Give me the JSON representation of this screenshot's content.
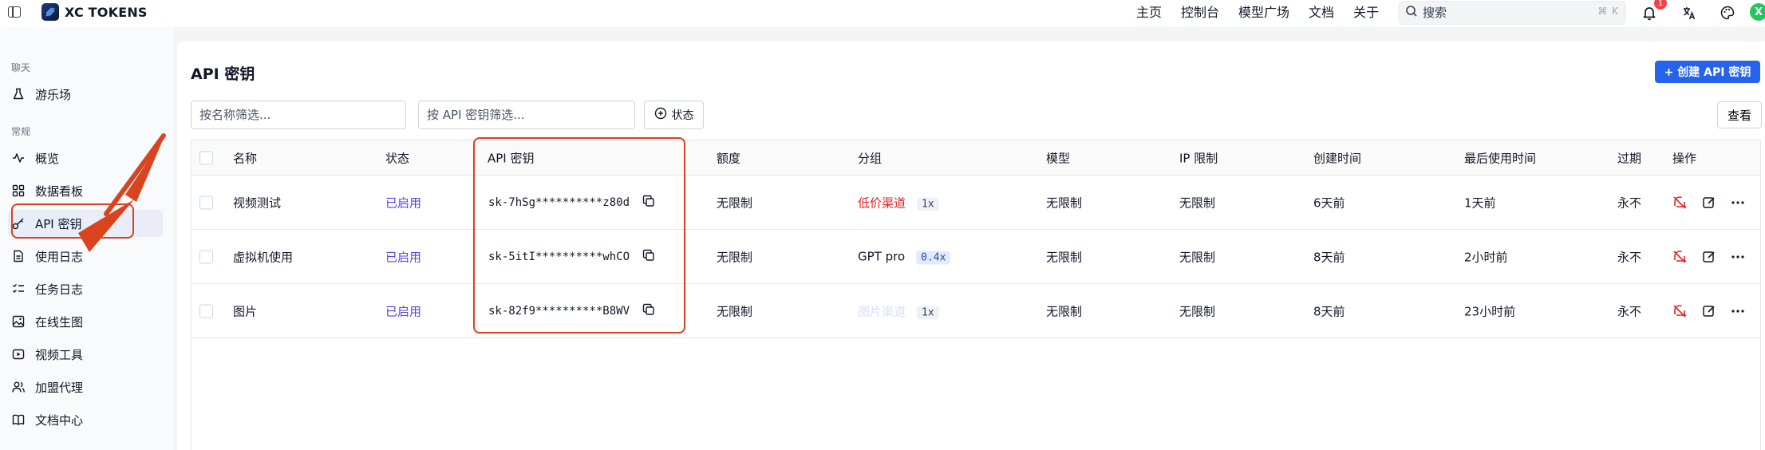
{
  "app": {
    "title": "XC TOKENS"
  },
  "topnav": {
    "items": [
      "主页",
      "控制台",
      "模型广场",
      "文档",
      "关于"
    ]
  },
  "search": {
    "placeholder": "搜索",
    "shortcut": "⌘ K"
  },
  "notifications": {
    "count": "1"
  },
  "user": {
    "avatar_letter": "X"
  },
  "sidebar": {
    "section_chat": "聊天",
    "section_general": "常规",
    "items": [
      {
        "label": "游乐场",
        "icon": "flask-icon"
      },
      {
        "label": "概览",
        "icon": "activity-icon"
      },
      {
        "label": "数据看板",
        "icon": "dashboard-icon"
      },
      {
        "label": "API 密钥",
        "icon": "key-icon",
        "active": true
      },
      {
        "label": "使用日志",
        "icon": "file-text-icon"
      },
      {
        "label": "任务日志",
        "icon": "list-checks-icon"
      },
      {
        "label": "在线生图",
        "icon": "image-icon"
      },
      {
        "label": "视频工具",
        "icon": "video-icon"
      },
      {
        "label": "加盟代理",
        "icon": "users-icon"
      },
      {
        "label": "文档中心",
        "icon": "book-icon"
      }
    ]
  },
  "page": {
    "title": "API 密钥",
    "create_label": "+ 创建 API 密钥",
    "filter_name_placeholder": "按名称筛选...",
    "filter_key_placeholder": "按 API 密钥筛选...",
    "status_filter_label": "状态",
    "view_label": "查看"
  },
  "table": {
    "headers": [
      "名称",
      "状态",
      "API 密钥",
      "额度",
      "分组",
      "模型",
      "IP 限制",
      "创建时间",
      "最后使用时间",
      "过期",
      "操作"
    ],
    "rows": [
      {
        "name": "视频测试",
        "status": "已启用",
        "key": "sk-7hSg**********z80d",
        "quota": "无限制",
        "group": "低价渠道",
        "group_style": "red",
        "ratio": "1x",
        "ratio_style": "gray",
        "model": "无限制",
        "ip": "无限制",
        "created": "6天前",
        "last_used": "1天前",
        "expires": "永不"
      },
      {
        "name": "虚拟机使用",
        "status": "已启用",
        "key": "sk-5itI**********whCO",
        "quota": "无限制",
        "group": "GPT pro",
        "group_style": "normal",
        "ratio": "0.4x",
        "ratio_style": "blue",
        "model": "无限制",
        "ip": "无限制",
        "created": "8天前",
        "last_used": "2小时前",
        "expires": "永不"
      },
      {
        "name": "图片",
        "status": "已启用",
        "key": "sk-82f9**********B8WV",
        "quota": "无限制",
        "group": "图片渠道",
        "group_style": "faint",
        "ratio": "1x",
        "ratio_style": "gray",
        "model": "无限制",
        "ip": "无限制",
        "created": "8天前",
        "last_used": "23小时前",
        "expires": "永不"
      }
    ]
  },
  "colors": {
    "accent": "#2563eb",
    "status_enabled": "#4f46e5",
    "annotation": "#d9431e",
    "group_red": "#dc2626"
  }
}
